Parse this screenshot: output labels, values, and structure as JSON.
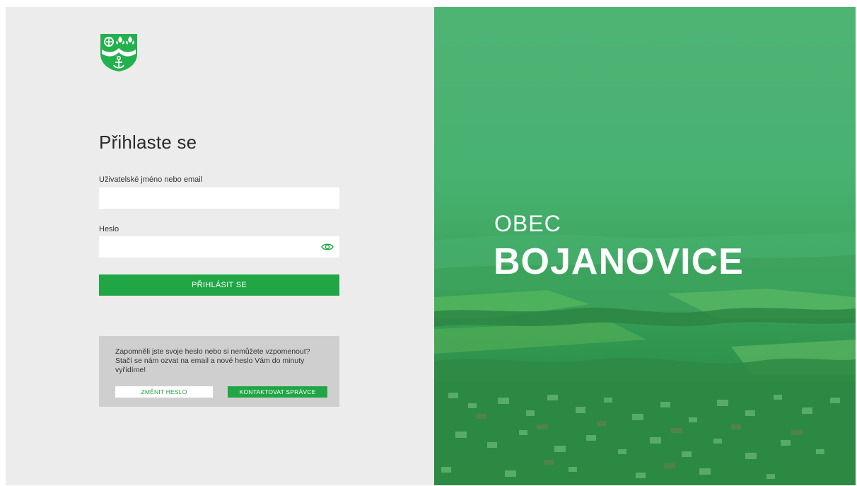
{
  "login": {
    "title": "Přihlaste se",
    "username_label": "Uživatelské jméno nebo email",
    "username_value": "",
    "password_label": "Heslo",
    "password_value": "",
    "submit_label": "PŘIHLÁSIT SE"
  },
  "help": {
    "text": "Zapomněli jste svoje heslo nebo si nemůžete vzpomenout? Stačí se nám ozvat na email a nové heslo Vám do minuty vyřídíme!",
    "change_password_label": "ZMĚNIT HESLO",
    "contact_admin_label": "KONTAKTOVAT SPRÁVCE"
  },
  "hero": {
    "subtitle": "OBEC",
    "title": "BOJANOVICE"
  },
  "icons": {
    "logo": "coat-of-arms-icon",
    "password_toggle": "eye-icon"
  },
  "colors": {
    "accent": "#21a645",
    "left_bg": "#ececec",
    "help_bg": "#cfcfcf",
    "hero_green": "#4eb277"
  }
}
